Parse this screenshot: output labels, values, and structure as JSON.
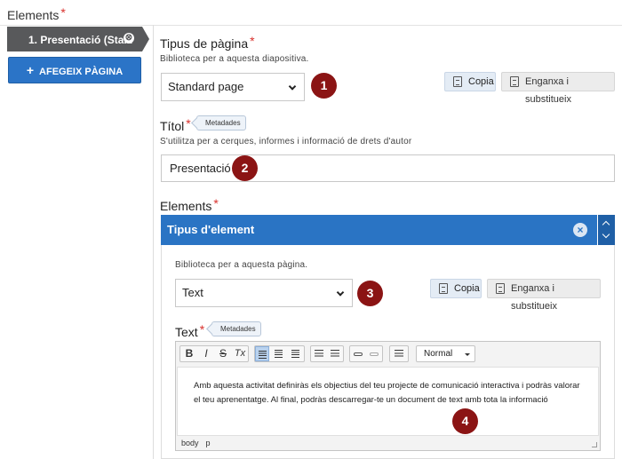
{
  "header": {
    "title": "Elements",
    "required": "*"
  },
  "sidebar": {
    "page_tab_label": "1. Presentació (Sta...",
    "page_tab_close": "⊗",
    "add_page_label": "AFEGEIX PÀGINA",
    "add_page_icon": "+"
  },
  "page_type": {
    "label": "Tipus de pàgina",
    "required": "*",
    "description": "Biblioteca per a aquesta diapositiva.",
    "selected": "Standard page",
    "copy_label": "Copia",
    "paste_label": "Enganxa i substitueix"
  },
  "title_field": {
    "label": "Títol",
    "required": "*",
    "metadata_label": "Metadades",
    "description": "S'utilitza per a cerques, informes i informació de drets d'autor",
    "value": "Presentació"
  },
  "elements": {
    "label": "Elements",
    "required": "*",
    "group_title": "Tipus d'element",
    "close_icon": "×",
    "description": "Biblioteca per a aquesta pàgina.",
    "selected": "Text",
    "copy_label": "Copia",
    "paste_label": "Enganxa i substitueix"
  },
  "text_field": {
    "label": "Text",
    "required": "*",
    "metadata_label": "Metadades",
    "toolbar": {
      "bold": "B",
      "italic": "I",
      "strike": "S",
      "clear": "Tx",
      "format": "Normal"
    },
    "content": "Amb aquesta activitat definiràs els objectius del teu projecte de comunicació interactiva i podràs valorar el teu aprenentatge. Al final, podràs descarregar-te un document de text amb tota la informació",
    "path": [
      "body",
      "p"
    ]
  },
  "markers": [
    "1",
    "2",
    "3",
    "4"
  ],
  "colors": {
    "accent": "#2a74c4",
    "marker": "#8b1414",
    "required": "#d9302c",
    "tab": "#58595b"
  }
}
